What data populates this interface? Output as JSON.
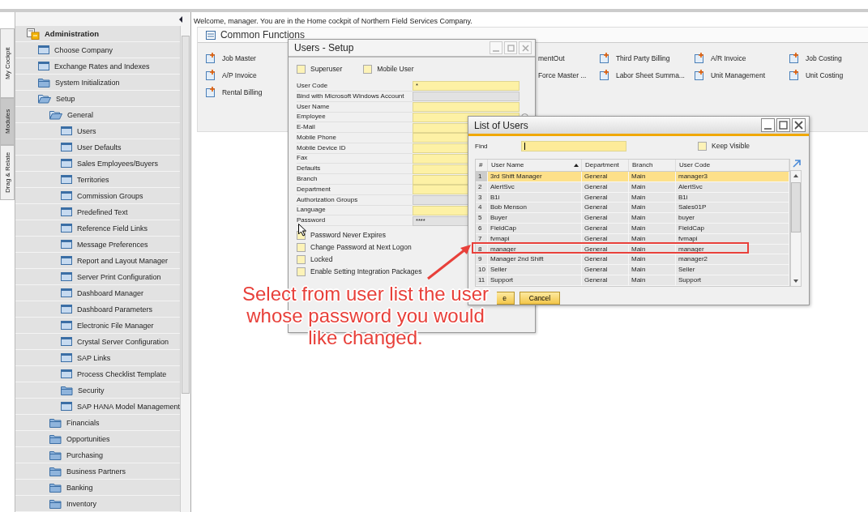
{
  "side_tabs": [
    {
      "label": "My Cockpit",
      "selected": false
    },
    {
      "label": "Modules",
      "selected": true
    },
    {
      "label": "Drag & Relate",
      "selected": false
    }
  ],
  "tree": [
    {
      "label": "Administration",
      "kind": "module",
      "expanded": true,
      "children": [
        {
          "label": "Choose Company",
          "kind": "form"
        },
        {
          "label": "Exchange Rates and Indexes",
          "kind": "form"
        },
        {
          "label": "System Initialization",
          "kind": "folder",
          "expanded": false
        },
        {
          "label": "Setup",
          "kind": "folder",
          "expanded": true,
          "children": [
            {
              "label": "General",
              "kind": "folder",
              "expanded": true,
              "children": [
                {
                  "label": "Users",
                  "kind": "form"
                },
                {
                  "label": "User Defaults",
                  "kind": "form"
                },
                {
                  "label": "Sales Employees/Buyers",
                  "kind": "form"
                },
                {
                  "label": "Territories",
                  "kind": "form"
                },
                {
                  "label": "Commission Groups",
                  "kind": "form"
                },
                {
                  "label": "Predefined Text",
                  "kind": "form"
                },
                {
                  "label": "Reference Field Links",
                  "kind": "form"
                },
                {
                  "label": "Message Preferences",
                  "kind": "form"
                },
                {
                  "label": "Report and Layout Manager",
                  "kind": "form"
                },
                {
                  "label": "Server Print Configuration",
                  "kind": "form"
                },
                {
                  "label": "Dashboard Manager",
                  "kind": "form"
                },
                {
                  "label": "Dashboard Parameters",
                  "kind": "form"
                },
                {
                  "label": "Electronic File Manager",
                  "kind": "form"
                },
                {
                  "label": "Crystal Server Configuration",
                  "kind": "form"
                },
                {
                  "label": "SAP Links",
                  "kind": "form"
                },
                {
                  "label": "Process Checklist Template",
                  "kind": "form"
                },
                {
                  "label": "Security",
                  "kind": "folder",
                  "expanded": false
                },
                {
                  "label": "SAP HANA Model Management",
                  "kind": "form"
                }
              ]
            },
            {
              "label": "Financials",
              "kind": "folder",
              "expanded": false
            },
            {
              "label": "Opportunities",
              "kind": "folder",
              "expanded": false
            },
            {
              "label": "Purchasing",
              "kind": "folder",
              "expanded": false
            },
            {
              "label": "Business Partners",
              "kind": "folder",
              "expanded": false
            },
            {
              "label": "Banking",
              "kind": "folder",
              "expanded": false
            },
            {
              "label": "Inventory",
              "kind": "folder",
              "expanded": false
            }
          ]
        }
      ]
    }
  ],
  "welcome": "Welcome, manager. You are in the Home cockpit of Northern Field Services Company.",
  "common_functions": {
    "title": "Common Functions",
    "left_items": [
      {
        "label": "Job Master"
      },
      {
        "label": "A/P Invoice"
      },
      {
        "label": "Rental Billing"
      }
    ],
    "right_rows": [
      [
        {
          "label": "mentOut",
          "kind": "clipped"
        },
        {
          "label": "Third Party Billing",
          "kind": "full"
        },
        {
          "label": "A/R Invoice",
          "kind": "full"
        },
        {
          "label": "Job Costing",
          "kind": "full"
        }
      ],
      [
        {
          "label": "Force Master ...",
          "kind": "clipped"
        },
        {
          "label": "Labor Sheet Summa...",
          "kind": "full"
        },
        {
          "label": "Unit Management",
          "kind": "full"
        },
        {
          "label": "Unit Costing",
          "kind": "full"
        }
      ]
    ]
  },
  "users_setup": {
    "title": "Users - Setup",
    "top_checks": [
      {
        "label": "Superuser",
        "checked": false
      },
      {
        "label": "Mobile User",
        "checked": false
      }
    ],
    "fields": [
      {
        "label": "User Code",
        "value": "*",
        "disabled": false,
        "kind": "text"
      },
      {
        "label": "Bind with Microsoft Windows Account",
        "disabled": true,
        "kind": "text"
      },
      {
        "label": "User Name",
        "disabled": false,
        "kind": "text"
      },
      {
        "label": "Employee",
        "disabled": false,
        "kind": "dropdown"
      },
      {
        "label": "E-Mail",
        "disabled": false,
        "kind": "text"
      },
      {
        "label": "Mobile Phone",
        "disabled": false,
        "kind": "text"
      },
      {
        "label": "Mobile Device ID",
        "disabled": false,
        "kind": "text"
      },
      {
        "label": "Fax",
        "disabled": false,
        "kind": "text"
      },
      {
        "label": "Defaults",
        "disabled": false,
        "kind": "text"
      },
      {
        "label": "Branch",
        "disabled": false,
        "kind": "text"
      },
      {
        "label": "Department",
        "disabled": false,
        "kind": "text"
      },
      {
        "label": "Authorization Groups",
        "disabled": true,
        "kind": "text"
      },
      {
        "label": "Language",
        "disabled": false,
        "kind": "text"
      },
      {
        "label": "Password",
        "value": "****",
        "disabled": true,
        "kind": "text"
      }
    ],
    "bottom_checks": [
      {
        "label": "Password Never Expires",
        "checked": false
      },
      {
        "label": "Change Password at Next Logon",
        "checked": false
      },
      {
        "label": "Locked",
        "checked": false
      },
      {
        "label": "Enable Setting Integration Packages",
        "checked": false
      }
    ]
  },
  "list_of_users": {
    "title": "List of Users",
    "find_label": "Find",
    "keep_visible": {
      "label": "Keep Visible",
      "checked": false
    },
    "columns": [
      "#",
      "User Name",
      "Department",
      "Branch",
      "User Code"
    ],
    "rows": [
      {
        "cells": [
          "1",
          "3rd Shift Manager",
          "General",
          "Main",
          "manager3"
        ],
        "selected": true,
        "boxed": false
      },
      {
        "cells": [
          "2",
          "AlertSvc",
          "General",
          "Main",
          "AlertSvc"
        ],
        "selected": false,
        "boxed": false
      },
      {
        "cells": [
          "3",
          "B1i",
          "General",
          "Main",
          "B1i"
        ],
        "selected": false,
        "boxed": false
      },
      {
        "cells": [
          "4",
          "Bob Menson",
          "General",
          "Main",
          "Sales01P"
        ],
        "selected": false,
        "boxed": false
      },
      {
        "cells": [
          "5",
          "Buyer",
          "General",
          "Main",
          "buyer"
        ],
        "selected": false,
        "boxed": false
      },
      {
        "cells": [
          "6",
          "FieldCap",
          "General",
          "Main",
          "FieldCap"
        ],
        "selected": false,
        "boxed": false
      },
      {
        "cells": [
          "7",
          "fvmapi",
          "General",
          "Main",
          "fvmapi"
        ],
        "selected": false,
        "boxed": false
      },
      {
        "cells": [
          "8",
          "manager",
          "General",
          "Main",
          "manager"
        ],
        "selected": false,
        "boxed": true
      },
      {
        "cells": [
          "9",
          "Manager 2nd Shift",
          "General",
          "Main",
          "manager2"
        ],
        "selected": false,
        "boxed": false
      },
      {
        "cells": [
          "10",
          "Seller",
          "General",
          "Main",
          "Seller"
        ],
        "selected": false,
        "boxed": false
      },
      {
        "cells": [
          "11",
          "Support",
          "General",
          "Main",
          "Support"
        ],
        "selected": false,
        "boxed": false
      }
    ],
    "buttons": [
      "e",
      "Cancel"
    ]
  },
  "callout": "Select from user list the user whose password you would like changed."
}
